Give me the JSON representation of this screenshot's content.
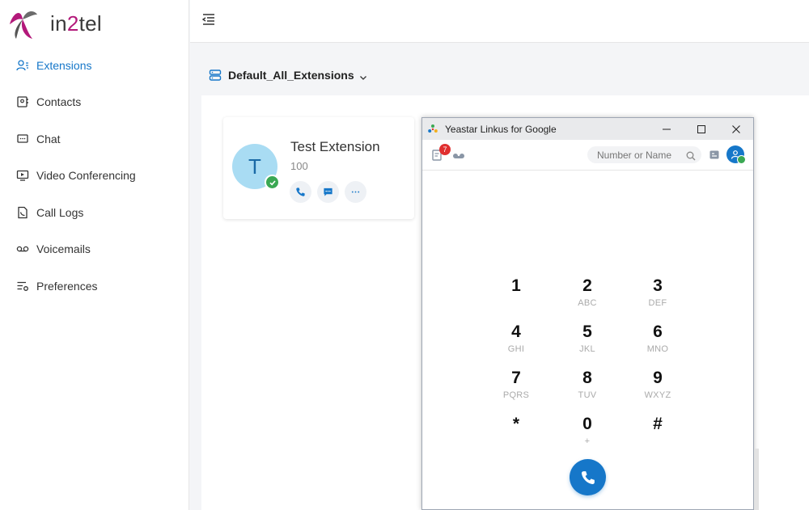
{
  "brand": {
    "logo_text_a": "in",
    "logo_text_b": "2",
    "logo_text_c": "tel",
    "color": "#b3197a"
  },
  "sidebar": {
    "items": [
      {
        "label": "Extensions",
        "icon": "extensions-icon",
        "active": true
      },
      {
        "label": "Contacts",
        "icon": "contacts-icon",
        "active": false
      },
      {
        "label": "Chat",
        "icon": "chat-icon",
        "active": false
      },
      {
        "label": "Video Conferencing",
        "icon": "video-conferencing-icon",
        "active": false
      },
      {
        "label": "Call Logs",
        "icon": "call-logs-icon",
        "active": false
      },
      {
        "label": "Voicemails",
        "icon": "voicemail-icon",
        "active": false
      },
      {
        "label": "Preferences",
        "icon": "preferences-icon",
        "active": false
      }
    ]
  },
  "group": {
    "name": "Default_All_Extensions"
  },
  "extension_card": {
    "avatar_letter": "T",
    "name": "Test Extension",
    "number": "100",
    "status": "available"
  },
  "popup": {
    "title": "Yeastar Linkus for Google",
    "unread_badge": "7",
    "search_placeholder": "Number or Name",
    "keypad": [
      {
        "digit": "1",
        "letters": ""
      },
      {
        "digit": "2",
        "letters": "ABC"
      },
      {
        "digit": "3",
        "letters": "DEF"
      },
      {
        "digit": "4",
        "letters": "GHI"
      },
      {
        "digit": "5",
        "letters": "JKL"
      },
      {
        "digit": "6",
        "letters": "MNO"
      },
      {
        "digit": "7",
        "letters": "PQRS"
      },
      {
        "digit": "8",
        "letters": "TUV"
      },
      {
        "digit": "9",
        "letters": "WXYZ"
      },
      {
        "digit": "*",
        "letters": ""
      },
      {
        "digit": "0",
        "letters": "+"
      },
      {
        "digit": "#",
        "letters": ""
      }
    ]
  },
  "colors": {
    "accent": "#1677c9",
    "status_ok": "#3aa853",
    "badge": "#e02f2f"
  }
}
